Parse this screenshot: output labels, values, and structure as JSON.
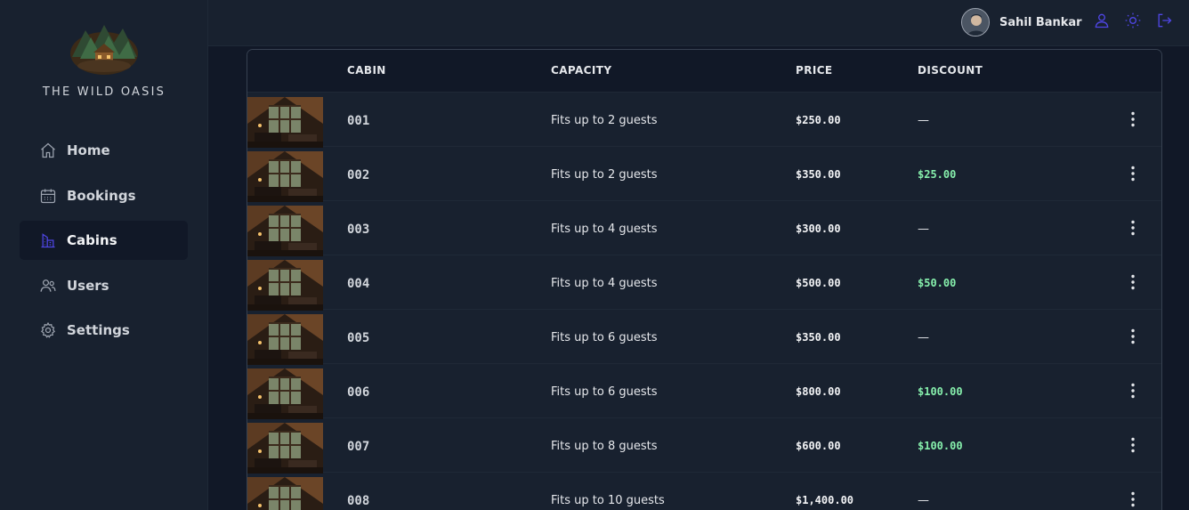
{
  "brand": {
    "name": "THE WILD OASIS"
  },
  "nav": {
    "items": [
      {
        "label": "Home",
        "icon": "home-icon"
      },
      {
        "label": "Bookings",
        "icon": "calendar-icon"
      },
      {
        "label": "Cabins",
        "icon": "building-icon",
        "active": true
      },
      {
        "label": "Users",
        "icon": "users-icon"
      },
      {
        "label": "Settings",
        "icon": "gear-icon"
      }
    ]
  },
  "header": {
    "username": "Sahil Bankar"
  },
  "table": {
    "columns": [
      "CABIN",
      "CAPACITY",
      "PRICE",
      "DISCOUNT"
    ],
    "rows": [
      {
        "name": "001",
        "capacity": "Fits up to 2 guests",
        "price": "$250.00",
        "discount": "—"
      },
      {
        "name": "002",
        "capacity": "Fits up to 2 guests",
        "price": "$350.00",
        "discount": "$25.00"
      },
      {
        "name": "003",
        "capacity": "Fits up to 4 guests",
        "price": "$300.00",
        "discount": "—"
      },
      {
        "name": "004",
        "capacity": "Fits up to 4 guests",
        "price": "$500.00",
        "discount": "$50.00"
      },
      {
        "name": "005",
        "capacity": "Fits up to 6 guests",
        "price": "$350.00",
        "discount": "—"
      },
      {
        "name": "006",
        "capacity": "Fits up to 6 guests",
        "price": "$800.00",
        "discount": "$100.00"
      },
      {
        "name": "007",
        "capacity": "Fits up to 8 guests",
        "price": "$600.00",
        "discount": "$100.00"
      },
      {
        "name": "008",
        "capacity": "Fits up to 10 guests",
        "price": "$1,400.00",
        "discount": "—"
      }
    ]
  },
  "colors": {
    "accent": "#4f46e5",
    "discount": "#86efac",
    "background": "#111827",
    "panel": "#18212f"
  }
}
